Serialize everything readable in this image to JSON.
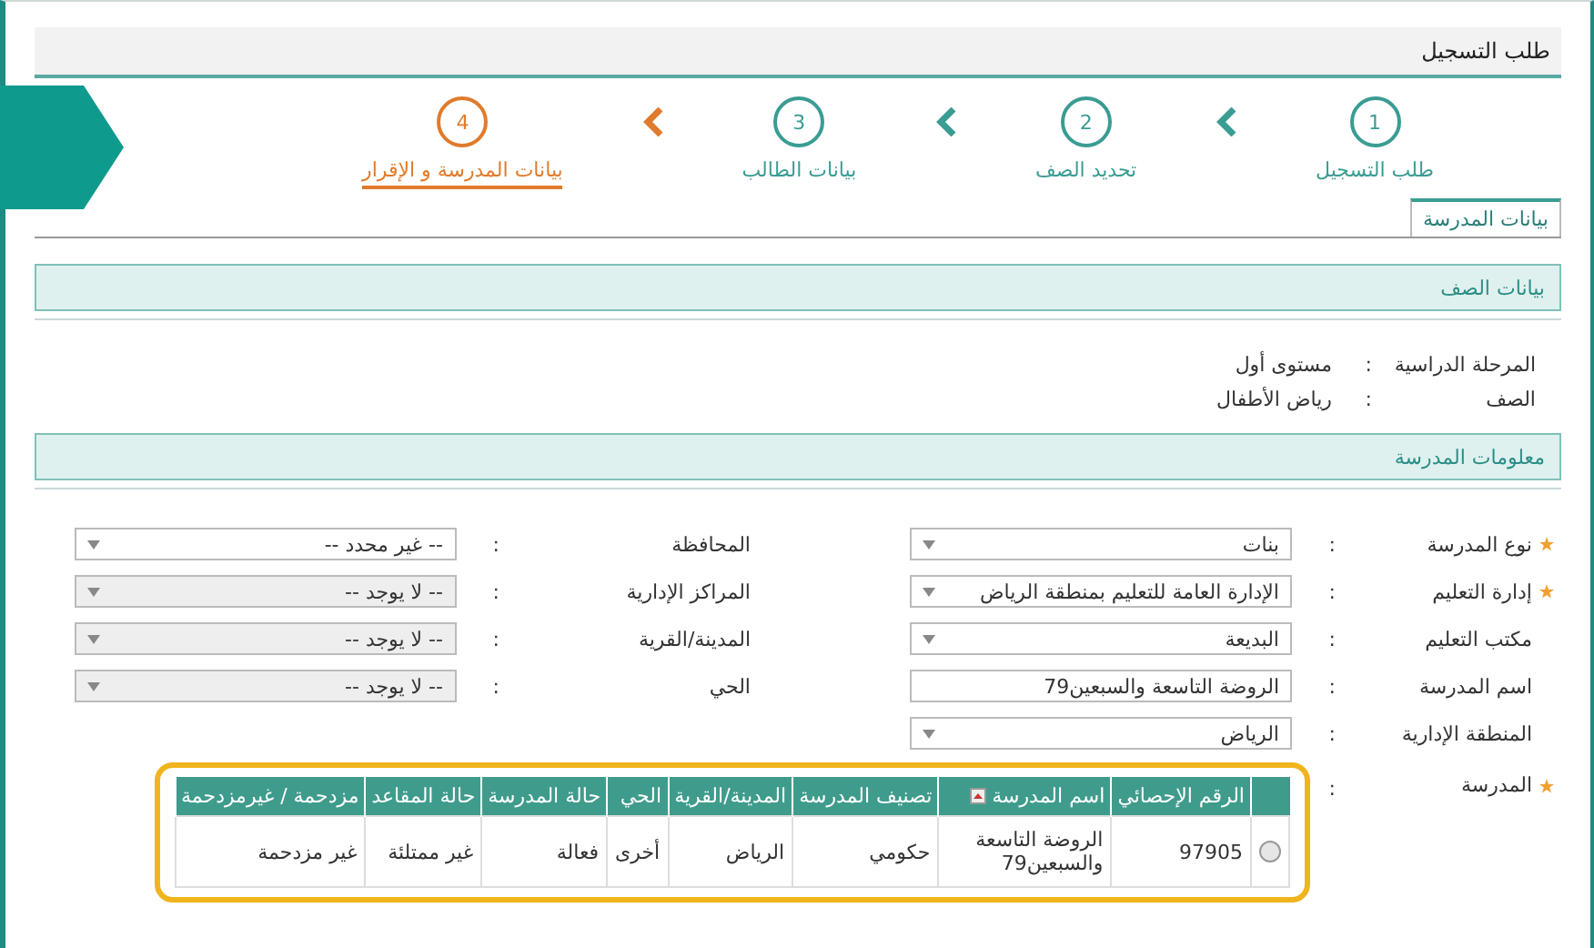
{
  "header": {
    "title": "طلب التسجيل"
  },
  "steps": [
    {
      "number": "1",
      "label": "طلب التسجيل",
      "selected": false
    },
    {
      "number": "2",
      "label": "تحديد الصف",
      "selected": false
    },
    {
      "number": "3",
      "label": "بيانات الطالب",
      "selected": false
    },
    {
      "number": "4",
      "label": "بيانات المدرسة و الإقرار",
      "selected": true
    }
  ],
  "tabs": [
    {
      "label": "بيانات المدرسة",
      "selected": true
    }
  ],
  "class_section": {
    "title": "بيانات الصف",
    "rows": [
      {
        "label": "المرحلة الدراسية",
        "colon": ":",
        "value": "مستوى أول"
      },
      {
        "label": "الصف",
        "colon": ":",
        "value": "رياض الأطفال"
      }
    ]
  },
  "school_section": {
    "title": "معلومات المدرسة",
    "fields_right": [
      {
        "label": "نوع المدرسة",
        "required": true,
        "colon": ":",
        "kind": "select",
        "value": "بنات",
        "disabled": false
      },
      {
        "label": "إدارة التعليم",
        "required": true,
        "colon": ":",
        "kind": "select",
        "value": "الإدارة العامة للتعليم بمنطقة الرياض",
        "disabled": false
      },
      {
        "label": "مكتب التعليم",
        "required": false,
        "colon": ":",
        "kind": "select",
        "value": "البديعة",
        "disabled": false
      },
      {
        "label": "اسم المدرسة",
        "required": false,
        "colon": ":",
        "kind": "input",
        "value": "الروضة التاسعة والسبعين79",
        "disabled": false
      },
      {
        "label": "المنطقة الإدارية",
        "required": false,
        "colon": ":",
        "kind": "select",
        "value": "الرياض",
        "disabled": false
      }
    ],
    "fields_left": [
      {
        "label": "المحافظة",
        "required": false,
        "colon": ":",
        "kind": "select",
        "value": "-- غير محدد --",
        "disabled": false
      },
      {
        "label": "المراكز الإدارية",
        "required": false,
        "colon": ":",
        "kind": "select",
        "value": "-- لا يوجد --",
        "disabled": true
      },
      {
        "label": "المدينة/القرية",
        "required": false,
        "colon": ":",
        "kind": "select",
        "value": "-- لا يوجد --",
        "disabled": true
      },
      {
        "label": "الحي",
        "required": false,
        "colon": ":",
        "kind": "select",
        "value": "-- لا يوجد --",
        "disabled": true
      }
    ],
    "school": {
      "label": "المدرسة",
      "required": true,
      "colon": ":",
      "table": {
        "columns": [
          {
            "label": "الرقم الإحصائي",
            "sort_icon": false
          },
          {
            "label": "اسم المدرسة",
            "sort_icon": true
          },
          {
            "label": "تصنيف المدرسة",
            "sort_icon": false
          },
          {
            "label": "المدينة/القرية",
            "sort_icon": false
          },
          {
            "label": "الحي",
            "sort_icon": false
          },
          {
            "label": "حالة المدرسة",
            "sort_icon": false
          },
          {
            "label": "حالة المقاعد",
            "sort_icon": false
          },
          {
            "label": "مزدحمة / غيرمزدحمة",
            "sort_icon": false
          }
        ],
        "rows": [
          {
            "selected": false,
            "cells": [
              "97905",
              "الروضة التاسعة والسبعين79",
              "حكومي",
              "الرياض",
              "أخرى",
              "فعالة",
              "غير ممتلئة",
              "غير مزدحمة"
            ]
          }
        ]
      }
    }
  }
}
